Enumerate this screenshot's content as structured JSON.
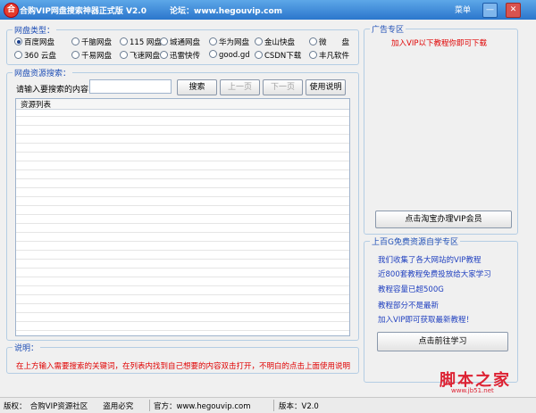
{
  "window": {
    "title": "合购VIP网盘搜索神器正式版 V2.0",
    "forum": "论坛：www.hegouvip.com",
    "menu": "菜单",
    "minimize": "—",
    "close": "✕"
  },
  "disk_types": {
    "label": "网盘类型：",
    "options": [
      "百度网盘",
      "千脑网盘",
      "115 网盘",
      "城通网盘",
      "华为网盘",
      "金山快盘",
      "微　　盘",
      "360 云盘",
      "千易网盘",
      "飞速网盘",
      "迅雷快传",
      "good.gd",
      "CSDN下载",
      "丰凡软件"
    ],
    "selected_index": 0
  },
  "search": {
    "group_label": "网盘资源搜索：",
    "prompt": "请输入要搜索的内容：",
    "input_value": "",
    "search_button": "搜索",
    "prev_button": "上一页",
    "next_button": "下一页",
    "help_button": "使用说明"
  },
  "results": {
    "column_header": "资源列表"
  },
  "notes": {
    "label": "说明：",
    "text": "在上方输入需要搜索的关键词，在列表内找到自己想要的内容双击打开，不明白的点击上面使用说明"
  },
  "ads": {
    "label": "广告专区",
    "text": "加入VIP以下教程你即可下载",
    "button": "点击淘宝办理VIP会员"
  },
  "learn": {
    "label": "上百G免费资源自学专区",
    "items": [
      "我们收集了各大网站的VIP教程",
      "近800套教程免费投放给大家学习",
      "教程容量已超500G",
      "教程部分不是最新",
      "加入VIP即可获取最新教程！"
    ],
    "button": "点击前往学习"
  },
  "status": {
    "copyright": "版权：　合购VIP资源社区　　盗用必究",
    "official": "官方：www.hegouvip.com",
    "version": "版本：V2.0"
  },
  "watermark": {
    "text": "脚本之家",
    "url": "www.jb51.net"
  },
  "colors": {
    "title_bar": "#2b76cc",
    "group_label": "#1f4fb6",
    "notice_red": "#e00000",
    "learn_blue": "#1f3fbf"
  }
}
